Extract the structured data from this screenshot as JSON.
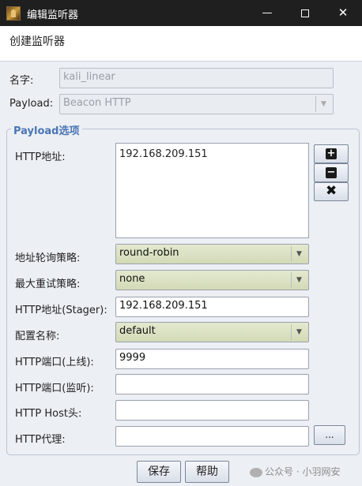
{
  "window": {
    "title": "编辑监听器",
    "minimize_glyph": "—",
    "close_glyph": "✕"
  },
  "header": {
    "text": "创建监听器"
  },
  "form": {
    "name": {
      "label": "名字:",
      "value": "kali_linear"
    },
    "payload": {
      "label": "Payload:",
      "value": "Beacon HTTP",
      "disabled": true
    }
  },
  "group": {
    "title": "Payload选项",
    "http_hosts": {
      "label": "HTTP地址:",
      "values": [
        "192.168.209.151"
      ]
    },
    "buttons": {
      "add": "+",
      "remove": "−",
      "clear": "✖"
    },
    "rotation": {
      "label": "地址轮询策略:",
      "value": "round-robin"
    },
    "max_retry": {
      "label": "最大重试策略:",
      "value": "none"
    },
    "stager_host": {
      "label": "HTTP地址(Stager):",
      "value": "192.168.209.151"
    },
    "profile": {
      "label": "配置名称:",
      "value": "default"
    },
    "port_bind": {
      "label": "HTTP端口(上线):",
      "value": "9999"
    },
    "port_listen": {
      "label": "HTTP端口(监听):",
      "value": ""
    },
    "host_header": {
      "label": "HTTP Host头:",
      "value": ""
    },
    "proxy": {
      "label": "HTTP代理:",
      "value": "",
      "browse_label": "..."
    }
  },
  "footer": {
    "save": "保存",
    "help": "帮助",
    "watermark": "公众号 · 小羽网安"
  },
  "icons": {
    "app": "listener-app-icon",
    "combo_arrow": "chevron-down-icon",
    "wechat": "wechat-icon"
  },
  "colors": {
    "titlebar": "#1f1f1f",
    "group_title": "#4a75b4",
    "combo_fill": "#d8dfbd"
  }
}
